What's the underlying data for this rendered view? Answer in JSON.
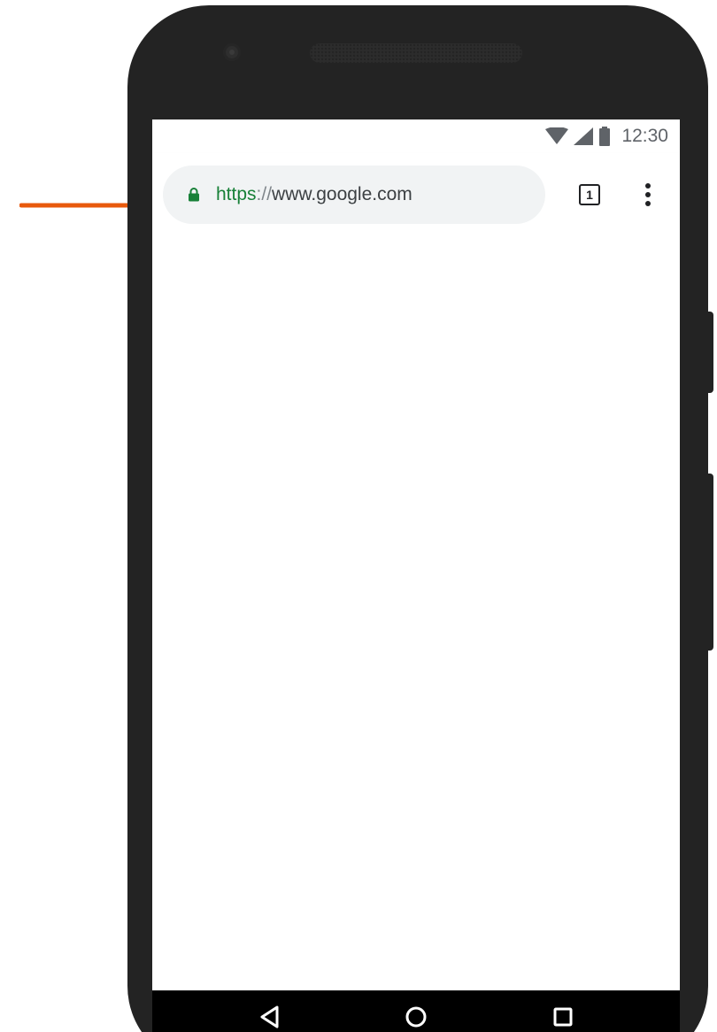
{
  "status_bar": {
    "time": "12:30",
    "icons": [
      "wifi-icon",
      "cell-signal-icon",
      "battery-icon"
    ]
  },
  "browser": {
    "url_scheme": "https",
    "url_separator": "://",
    "url_host": "www.google.com",
    "tab_count": "1",
    "icons": [
      "lock-icon",
      "tab-switcher-icon",
      "overflow-menu-icon"
    ]
  },
  "nav_bar": {
    "icons": [
      "back-icon",
      "home-icon",
      "recents-icon"
    ]
  },
  "colors": {
    "annotation_arrow": "#e8590c",
    "secure_scheme": "#188038",
    "omnibox_bg": "#f1f3f4",
    "phone_body": "#232323"
  }
}
